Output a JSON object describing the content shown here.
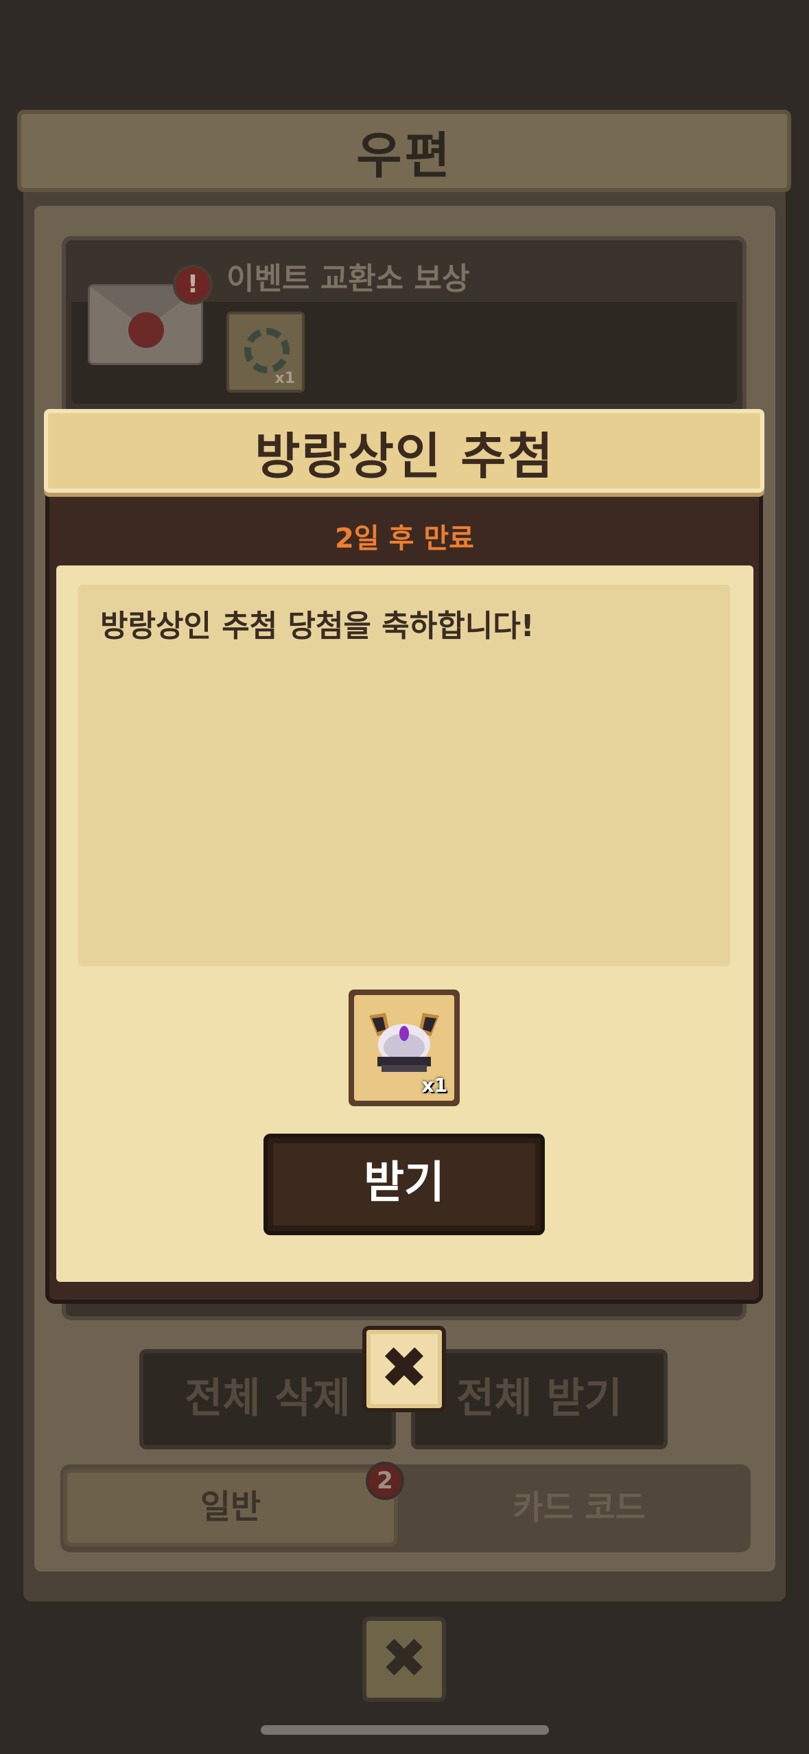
{
  "background_window": {
    "title": "우편",
    "mail_item": {
      "title": "이벤트 교환소 보상",
      "alert_symbol": "!",
      "attachment_qty": "x1"
    },
    "buttons": {
      "delete_all": "전체 삭제",
      "receive_all": "전체 받기"
    },
    "tabs": [
      {
        "label": "일반",
        "badge": "2"
      },
      {
        "label": "카드 코드"
      }
    ],
    "close_symbol": "✖"
  },
  "modal": {
    "title": "방랑상인 추첨",
    "expiry": "2일 후 만료",
    "message": "방랑상인 추첨 당첨을 축하합니다!",
    "reward_qty": "x1",
    "receive_label": "받기",
    "close_symbol": "✖"
  },
  "colors": {
    "accent_orange": "#ef7e33",
    "parchment": "#efe0ae",
    "title_bar": "#e7cf92",
    "dark_brown": "#3c2a22"
  }
}
